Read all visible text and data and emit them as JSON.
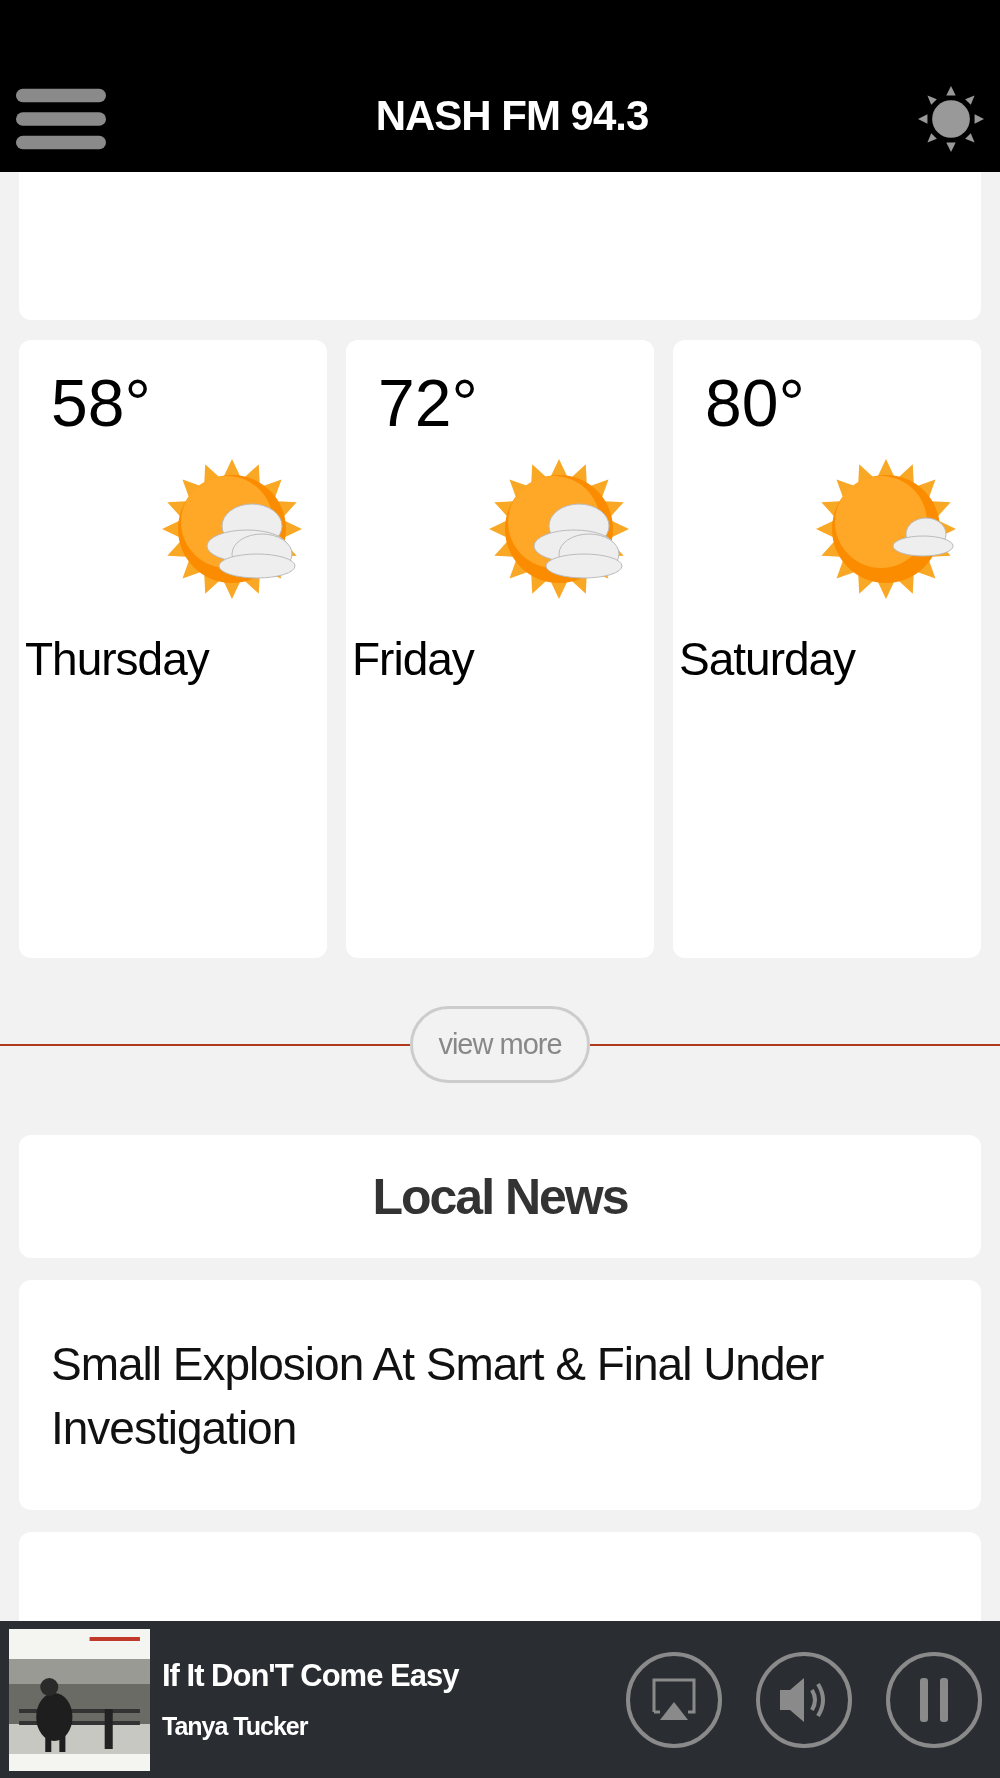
{
  "header": {
    "title": "NASH FM 94.3"
  },
  "forecast": [
    {
      "temp": "58°",
      "day": "Thursday",
      "kind": "clouds"
    },
    {
      "temp": "72°",
      "day": "Friday",
      "kind": "clouds"
    },
    {
      "temp": "80°",
      "day": "Saturday",
      "kind": "cloud"
    }
  ],
  "view_more": "view more",
  "local_news": {
    "title": "Local News",
    "items": [
      "Small Explosion At Smart & Final Under Investigation"
    ]
  },
  "player": {
    "track": "If It Don'T Come Easy",
    "artist": "Tanya Tucker"
  }
}
